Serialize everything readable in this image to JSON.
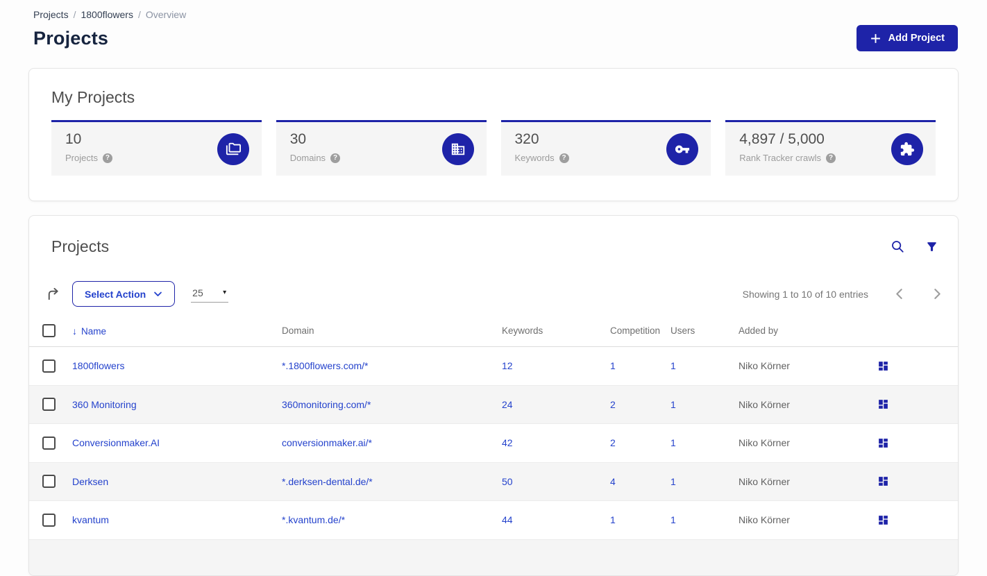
{
  "colors": {
    "brand": "#1e23a8",
    "link": "#2442cc"
  },
  "icons": {
    "sort_desc": "↓",
    "help": "?",
    "caret_down": "▾"
  },
  "breadcrumb": {
    "sep": "/",
    "items": [
      "Projects",
      "1800flowers",
      "Overview"
    ]
  },
  "header": {
    "title": "Projects",
    "add_project_label": "Add Project"
  },
  "my_projects": {
    "title": "My Projects",
    "stats": [
      {
        "value": "10",
        "label": "Projects",
        "icon": "projects-folders-icon"
      },
      {
        "value": "30",
        "label": "Domains",
        "icon": "domain-building-icon"
      },
      {
        "value": "320",
        "label": "Keywords",
        "icon": "key-icon"
      },
      {
        "value": "4,897 / 5,000",
        "label": "Rank Tracker crawls",
        "icon": "puzzle-icon"
      }
    ]
  },
  "projects_panel": {
    "title": "Projects",
    "toolbar": {
      "select_action_label": "Select Action",
      "page_size": "25",
      "showing_text": "Showing 1 to 10 of 10 entries"
    },
    "table": {
      "columns": [
        "Name",
        "Domain",
        "Keywords",
        "Competition",
        "Users",
        "Added by"
      ],
      "rows": [
        {
          "name": "1800flowers",
          "domain": "*.1800flowers.com/*",
          "keywords": "12",
          "competition": "1",
          "users": "1",
          "added_by": "Niko Körner"
        },
        {
          "name": "360 Monitoring",
          "domain": "360monitoring.com/*",
          "keywords": "24",
          "competition": "2",
          "users": "1",
          "added_by": "Niko Körner"
        },
        {
          "name": "Conversionmaker.AI",
          "domain": "conversionmaker.ai/*",
          "keywords": "42",
          "competition": "2",
          "users": "1",
          "added_by": "Niko Körner"
        },
        {
          "name": "Derksen",
          "domain": "*.derksen-dental.de/*",
          "keywords": "50",
          "competition": "4",
          "users": "1",
          "added_by": "Niko Körner"
        },
        {
          "name": "kvantum",
          "domain": "*.kvantum.de/*",
          "keywords": "44",
          "competition": "1",
          "users": "1",
          "added_by": "Niko Körner"
        }
      ]
    }
  }
}
